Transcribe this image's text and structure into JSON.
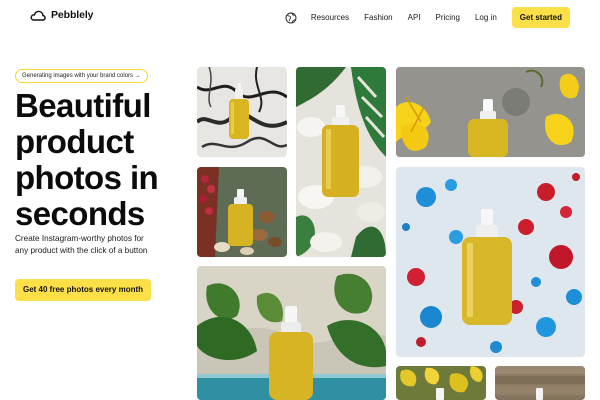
{
  "header": {
    "logo_icon": "cloud-logo-icon",
    "brand": "Pebblely",
    "language_icon": "globe-icon",
    "nav": [
      {
        "label": "Resources"
      },
      {
        "label": "Fashion"
      },
      {
        "label": "API"
      },
      {
        "label": "Pricing"
      },
      {
        "label": "Log in"
      }
    ],
    "cta": "Get started"
  },
  "hero": {
    "badge": "Generating images with your brand colors →",
    "title": "Beautiful product photos in seconds",
    "subtitle": "Create Instagram-worthy photos for any product with the click of a button",
    "cta": "Get 40 free photos every month"
  },
  "gallery": {
    "items": [
      {
        "scene": "marble background"
      },
      {
        "scene": "white stones with monstera leaves"
      },
      {
        "scene": "yellow flowers on grey stone"
      },
      {
        "scene": "green table with berries and nuts"
      },
      {
        "scene": "colorful paint splashes"
      },
      {
        "scene": "tropical leaves by the pool"
      },
      {
        "scene": "yellow leaves"
      },
      {
        "scene": "wooden plank background"
      }
    ]
  },
  "colors": {
    "accent": "#fde047",
    "text": "#111111",
    "background": "#ffffff"
  }
}
